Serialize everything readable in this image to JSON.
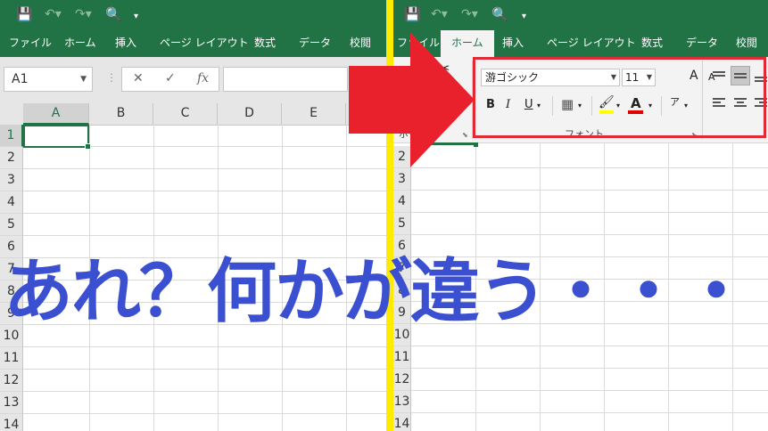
{
  "tabs": [
    "ファイル",
    "ホーム",
    "挿入",
    "ページ レイアウト",
    "数式",
    "データ",
    "校閲"
  ],
  "left": {
    "namebox": "A1",
    "columns": [
      "A",
      "B",
      "C",
      "D",
      "E"
    ],
    "rows": [
      "1",
      "2",
      "3",
      "4",
      "5",
      "6",
      "7",
      "8",
      "9",
      "10",
      "11",
      "12",
      "13",
      "14"
    ]
  },
  "right": {
    "active_tab": "ホーム",
    "font_name": "游ゴシック",
    "font_size": "11",
    "grow_label": "A",
    "shrink_label": "A",
    "bold": "B",
    "italic": "I",
    "underline": "U",
    "font_group_label": "フォント",
    "clipboard_group_label": "ボード",
    "rows": [
      "2",
      "3",
      "4",
      "5",
      "6",
      "7",
      "8",
      "9",
      "10",
      "11",
      "12",
      "13",
      "14"
    ]
  },
  "overlay_text": "あれ？何かが違う・・・",
  "colors": {
    "excel_green": "#217346",
    "highlight_red": "#e02a34",
    "divider_yellow": "#ffeb00",
    "overlay_blue": "#3b4fd1"
  }
}
